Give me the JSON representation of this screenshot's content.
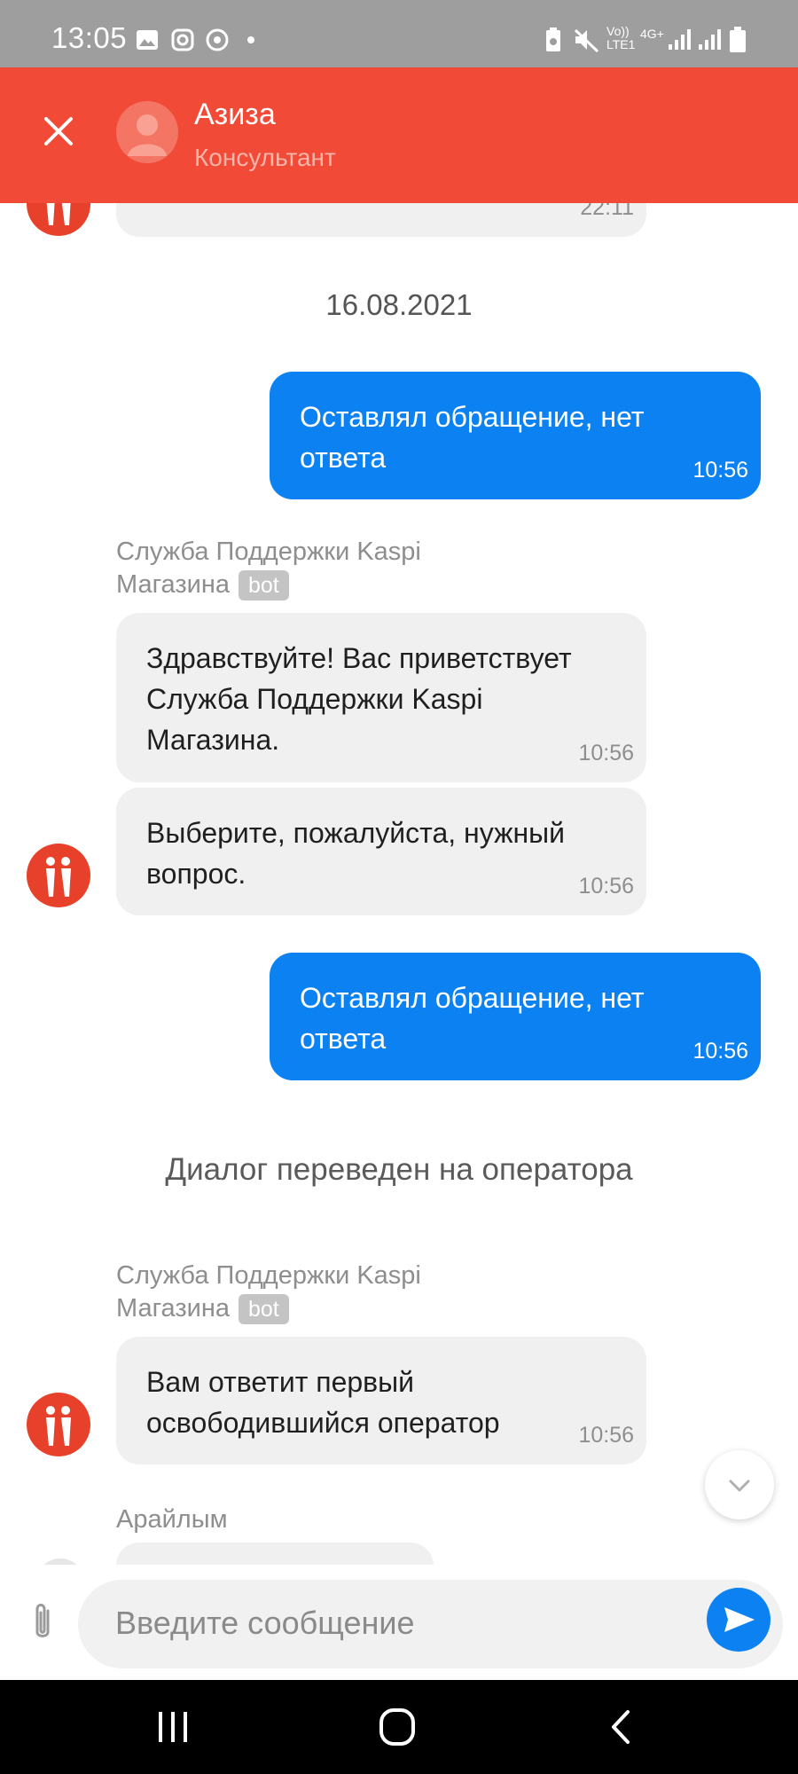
{
  "status_bar": {
    "time": "13:05",
    "left_icons": [
      "image-icon",
      "instagram-icon",
      "chrome-icon",
      "dot-icon"
    ],
    "right_icons": [
      "battery-saver-icon",
      "mute-icon",
      "volte-icon",
      "4g-icon",
      "signal-icon",
      "signal-icon",
      "battery-icon"
    ],
    "volte_text": "Vo)) LTE1",
    "network_text": "4G+"
  },
  "header": {
    "name": "Азиза",
    "role": "Консультант",
    "color": "#f14b37"
  },
  "messages": {
    "partial_prev_time": "22:11",
    "date_separator": "16.08.2021",
    "out_1": {
      "text": "Оставлял обращение, нет ответа",
      "time": "10:56"
    },
    "bot_sender_1": {
      "name": "Служба Поддержки Kaspi Магазина",
      "badge": "bot"
    },
    "in_1": {
      "text": "Здравствуйте! Вас приветствует Служба Поддержки Kaspi Магазина.",
      "time": "10:56"
    },
    "in_2": {
      "text": "Выберите, пожалуйста, нужный вопрос.",
      "time": "10:56"
    },
    "out_2": {
      "text": "Оставлял обращение, нет ответа",
      "time": "10:56"
    },
    "system": "Диалог переведен на оператора",
    "bot_sender_2": {
      "name": "Служба Поддержки Kaspi Магазина",
      "badge": "bot"
    },
    "in_3": {
      "text": "Вам ответит первый освободившийся оператор",
      "time": "10:56"
    },
    "operator_sender": "Арайлым"
  },
  "input": {
    "placeholder": "Введите сообщение",
    "value": ""
  },
  "colors": {
    "outgoing_bubble": "#0c82f2",
    "incoming_bubble": "#f0f0f0",
    "brand_red": "#e8412b"
  }
}
